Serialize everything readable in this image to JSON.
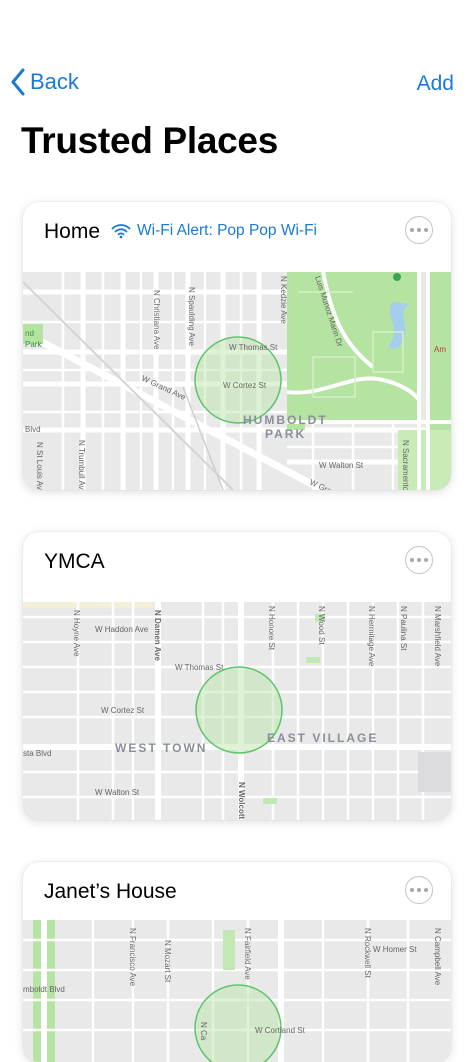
{
  "nav": {
    "back_label": "Back",
    "add_label": "Add"
  },
  "page": {
    "title": "Trusted Places"
  },
  "places": [
    {
      "name": "Home",
      "wifi_alert": "Wi-Fi Alert: Pop Pop Wi-Fi",
      "map": {
        "area_label": "HUMBOLDT",
        "area_label_2": "PARK",
        "streets": [
          "N Christiana Ave",
          "N Spaulding Ave",
          "N Kedzie Ave",
          "W Thomas St",
          "W Cortez St",
          "W Grand Ave",
          "W Walton St",
          "W Grand",
          "N Trumbull Ave",
          "N St Louis Ave",
          "N Sacramento",
          "Luis Munoz Marin Dr",
          "Blvd",
          "nd",
          "Park",
          "Am"
        ]
      }
    },
    {
      "name": "YMCA",
      "wifi_alert": "",
      "map": {
        "area_label": "WEST TOWN",
        "area_label_2": "EAST VILLAGE",
        "streets": [
          "N Hoyne Ave",
          "W Haddon Ave",
          "N Damen Ave",
          "W Thomas St",
          "W Cortez St",
          "N Wolcott",
          "N Honore St",
          "N Wood St",
          "N Hermitage Ave",
          "N Paulina St",
          "N Marshfield Ave",
          "W Walton St",
          "sta Blvd"
        ]
      }
    },
    {
      "name": "Janet’s House",
      "wifi_alert": "",
      "map": {
        "area_label": "",
        "area_label_2": "",
        "streets": [
          "N Francisco Ave",
          "N Mozart St",
          "N Fairfield Ave",
          "N Rockwell St",
          "W Homer St",
          "N Campbell Ave",
          "W Cortland St",
          "mboldt Blvd",
          "N Ca"
        ]
      }
    }
  ],
  "colors": {
    "accent": "#1a7bd6",
    "park": "#b5e3a1",
    "geofence_stroke": "#5cc46a"
  }
}
